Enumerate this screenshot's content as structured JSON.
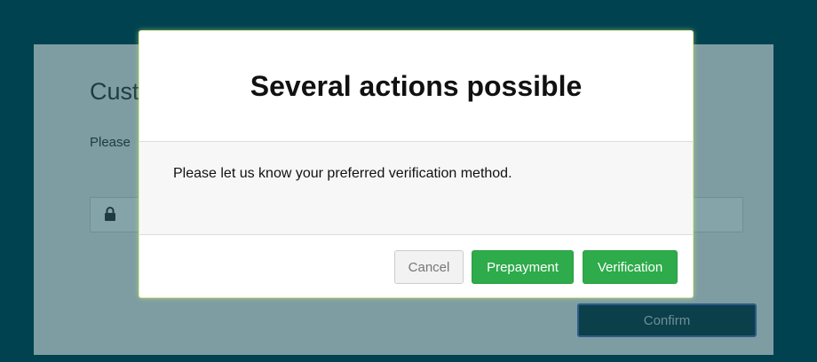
{
  "background_page": {
    "title_fragment": "Cust",
    "text_fragment": "Please",
    "confirm_label": "Confirm",
    "lock_icon": "lock-icon"
  },
  "modal": {
    "title": "Several actions possible",
    "message": "Please let us know your preferred verification method.",
    "buttons": {
      "cancel": "Cancel",
      "prepayment": "Prepayment",
      "verification": "Verification"
    }
  },
  "colors": {
    "page_background": "#00424f",
    "overlay_panel": "#7e9da2",
    "accent_green": "#2eab4b",
    "confirm_button": "#0b3f4a"
  }
}
